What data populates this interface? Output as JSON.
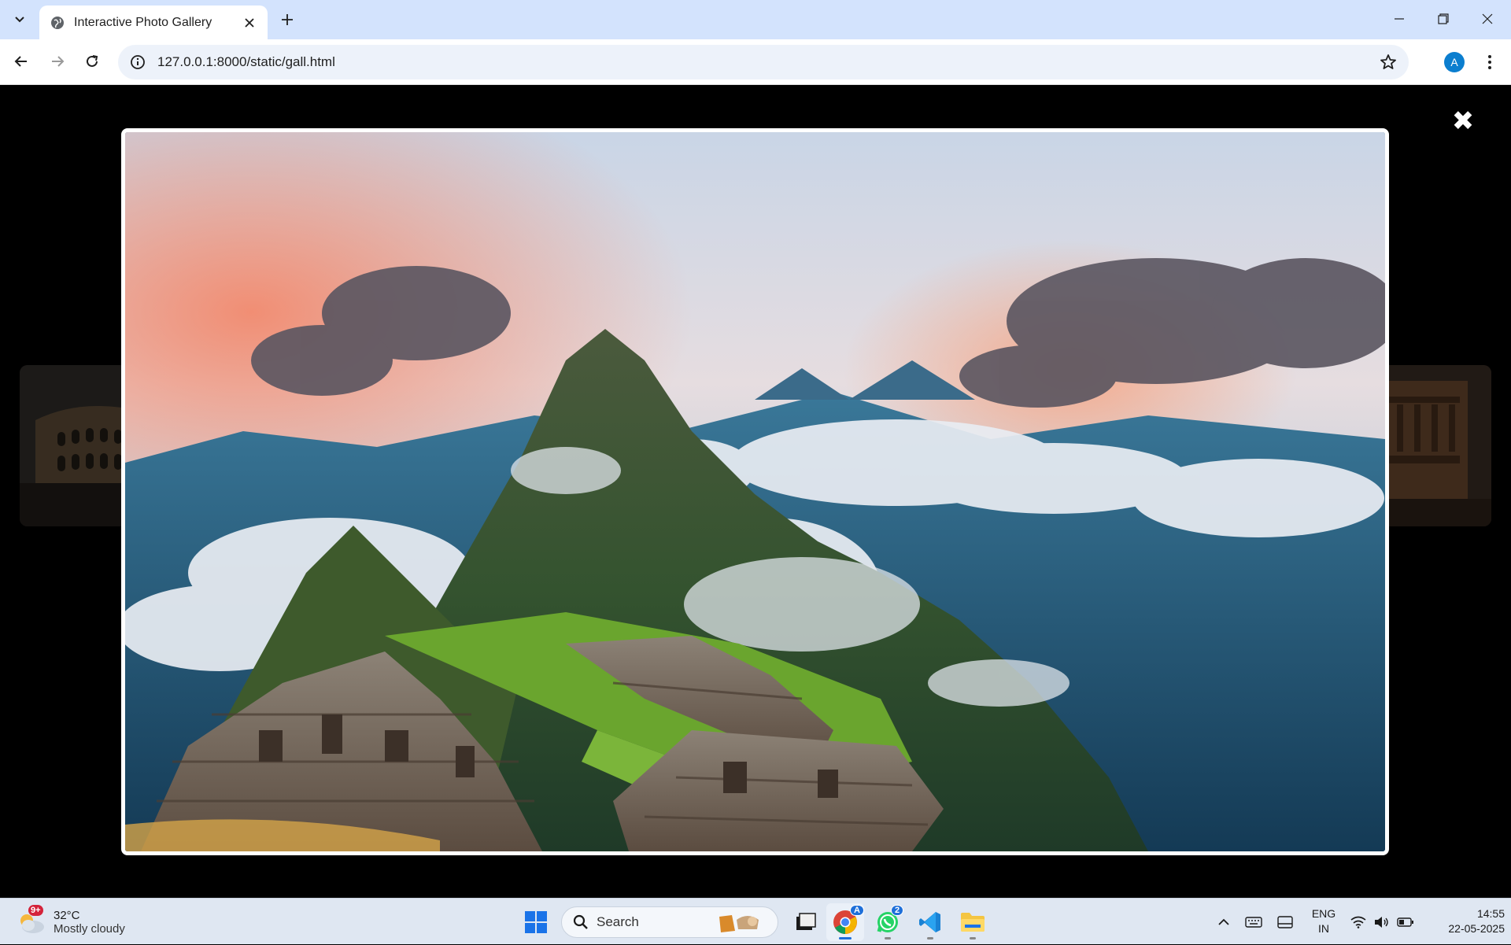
{
  "browser": {
    "tab": {
      "title": "Interactive Photo Gallery"
    },
    "address_bar": {
      "url": "127.0.0.1:8000/static/gall.html"
    },
    "profile_initial": "A"
  },
  "gallery": {
    "close_symbol": "✖",
    "current_image": "Machu Picchu",
    "prev_thumbnail": "Colosseum",
    "next_thumbnail": "Petra"
  },
  "taskbar": {
    "weather": {
      "temperature": "32°C",
      "condition": "Mostly cloudy",
      "badge": "9+"
    },
    "search_label": "Search",
    "whatsapp_badge": "2",
    "chrome_badge": "A",
    "language": {
      "line1": "ENG",
      "line2": "IN"
    },
    "clock": {
      "time": "14:55",
      "date": "22-05-2025"
    }
  },
  "colors": {
    "tabstrip": "#d3e3fd",
    "omnibox": "#edf2fa",
    "accent": "#0b7ecf",
    "taskbar": "#dfe7f2"
  }
}
